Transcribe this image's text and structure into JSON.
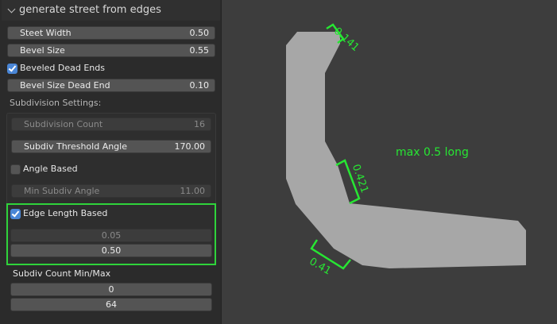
{
  "panel": {
    "title": "generate street from edges",
    "street_width": {
      "label": "Steet Width",
      "value": "0.50"
    },
    "bevel_size": {
      "label": "Bevel Size",
      "value": "0.55"
    },
    "beveled_dead_ends": {
      "label": "Beveled Dead Ends",
      "checked": true
    },
    "bevel_size_dead_end": {
      "label": "Bevel Size Dead End",
      "value": "0.10"
    },
    "subdivision_settings": {
      "heading": "Subdivision Settings:",
      "subdivision_count": {
        "label": "Subdivision Count",
        "value": "16"
      },
      "threshold_angle": {
        "label": "Subdiv Threshold Angle",
        "value": "170.00"
      },
      "angle_based": {
        "label": "Angle Based",
        "checked": false
      },
      "min_subdiv_angle": {
        "label": "Min Subdiv Angle",
        "value": "11.00"
      },
      "edge_length_based": {
        "label": "Edge Length Based",
        "checked": true
      },
      "edge_length_values": [
        "0.05",
        "0.50"
      ]
    },
    "subdiv_count_minmax": {
      "label": "Subdiv Count Min/Max",
      "values": [
        "0",
        "64"
      ]
    }
  },
  "annotations": {
    "top_edge": "0.141",
    "middle_edge": "0.421",
    "bottom_edge": "0.41",
    "note": "max 0.5 long"
  },
  "colors": {
    "accent_green": "#27e633",
    "checkbox_blue": "#4a86d6",
    "shape_fill": "#a7a7a7"
  }
}
